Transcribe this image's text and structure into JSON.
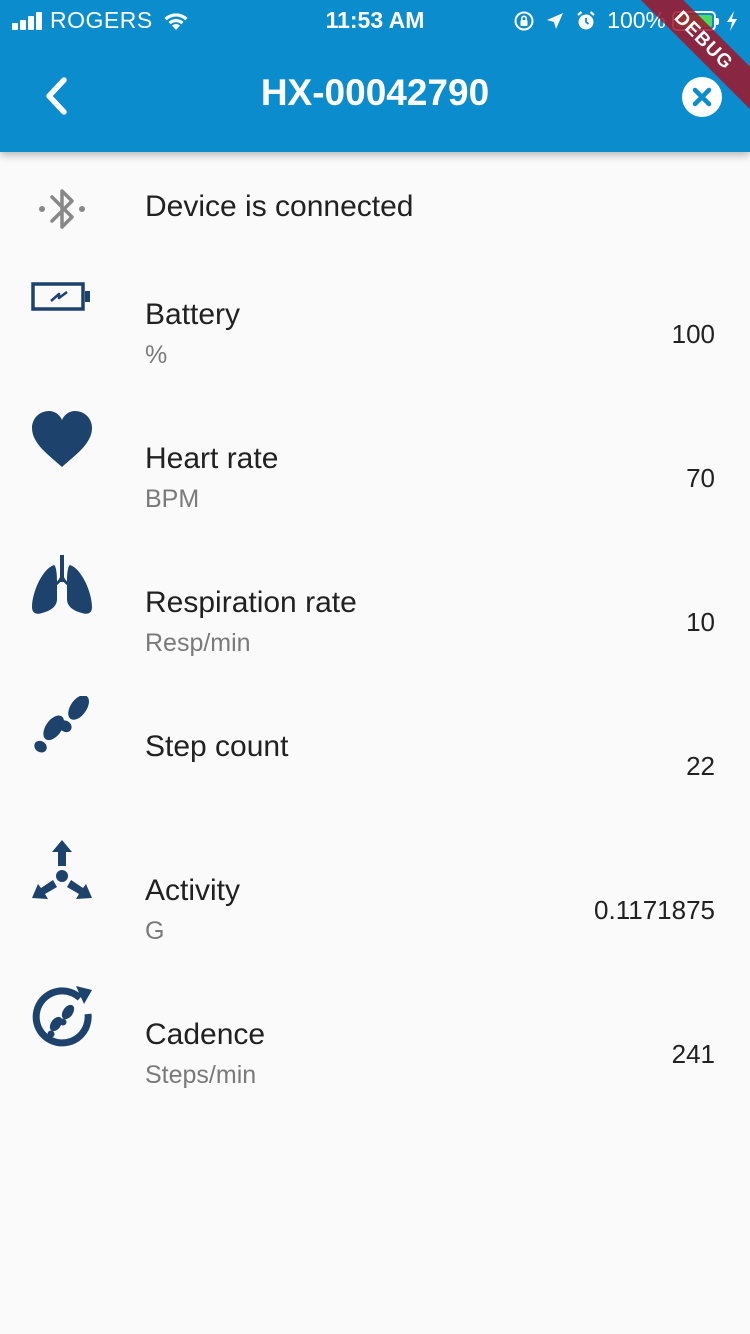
{
  "status_bar": {
    "carrier": "ROGERS",
    "time": "11:53 AM",
    "battery_percent": "100%",
    "battery_level": 1.0
  },
  "debug_banner": "DEBUG",
  "app_bar": {
    "title": "HX-00042790",
    "color": "#0b8ccd"
  },
  "connection": {
    "label": "Device is connected",
    "icon": "bluetooth-connected-icon"
  },
  "metrics": [
    {
      "label": "Battery",
      "unit": "%",
      "value": "100",
      "icon": "battery-charging-icon"
    },
    {
      "label": "Heart rate",
      "unit": "BPM",
      "value": "70",
      "icon": "heart-icon"
    },
    {
      "label": "Respiration rate",
      "unit": "Resp/min",
      "value": "10",
      "icon": "lungs-icon"
    },
    {
      "label": "Step count",
      "unit": "",
      "value": "22",
      "icon": "footprints-icon"
    },
    {
      "label": "Activity",
      "unit": "G",
      "value": "0.1171875",
      "icon": "activity-arrows-icon"
    },
    {
      "label": "Cadence",
      "unit": "Steps/min",
      "value": "241",
      "icon": "cadence-icon"
    }
  ],
  "icon_color": "#1d426b"
}
